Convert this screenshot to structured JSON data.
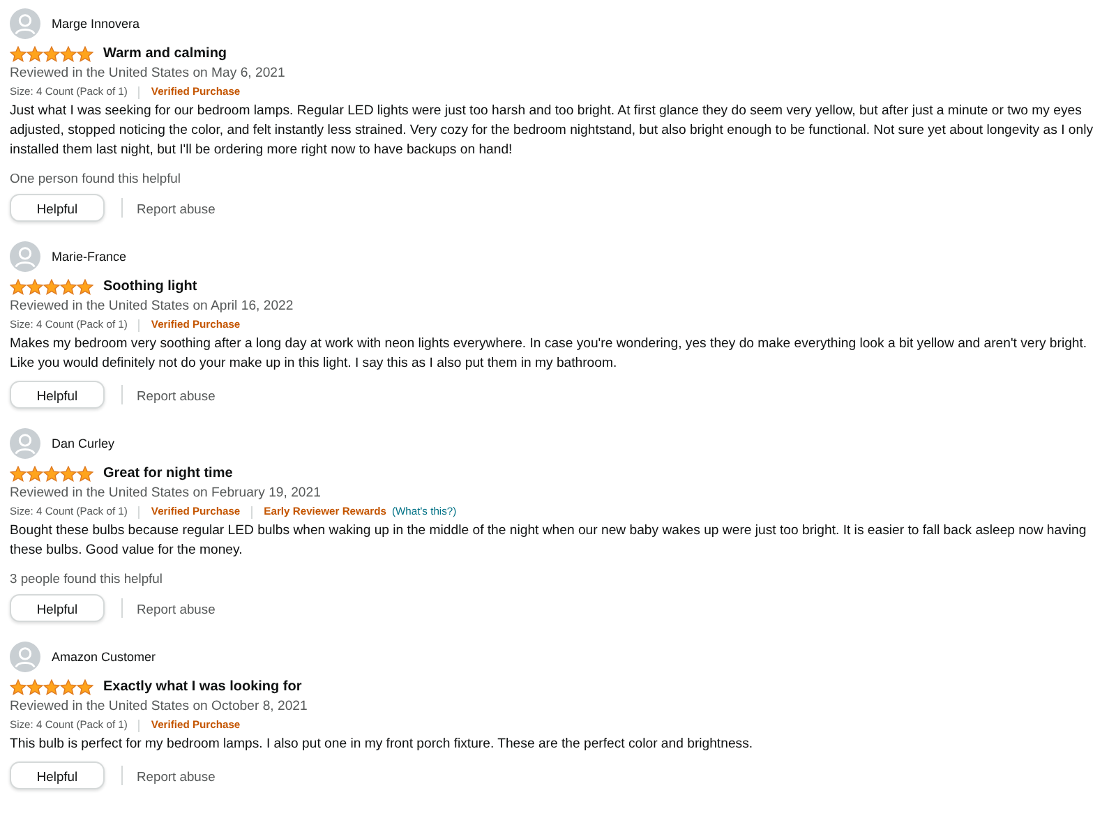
{
  "reviews": [
    {
      "author": "Marge Innovera",
      "stars": 5,
      "title": "Warm and calming",
      "date": "Reviewed in the United States on May 6, 2021",
      "size": "Size: 4 Count (Pack of 1)",
      "badges": [
        {
          "kind": "verified",
          "text": "Verified Purchase"
        }
      ],
      "body": "Just what I was seeking for our bedroom lamps. Regular LED lights were just too harsh and too bright. At first glance they do seem very yellow, but after just a minute or two my eyes adjusted, stopped noticing the color, and felt instantly less strained. Very cozy for the bedroom nightstand, but also bright enough to be functional. Not sure yet about longevity as I only installed them last night, but I'll be ordering more right now to have backups on hand!",
      "helpful_count": "One person found this helpful",
      "helpful_button": "Helpful",
      "report": "Report abuse"
    },
    {
      "author": "Marie-France",
      "stars": 5,
      "title": "Soothing light",
      "date": "Reviewed in the United States on April 16, 2022",
      "size": "Size: 4 Count (Pack of 1)",
      "badges": [
        {
          "kind": "verified",
          "text": "Verified Purchase"
        }
      ],
      "body": "Makes my bedroom very soothing after a long day at work with neon lights everywhere. In case you're wondering, yes they do make everything look a bit yellow and aren't very bright. Like you would definitely not do your make up in this light. I say this as I also put them in my bathroom.",
      "helpful_button": "Helpful",
      "report": "Report abuse"
    },
    {
      "author": "Dan Curley",
      "stars": 5,
      "title": "Great for night time",
      "date": "Reviewed in the United States on February 19, 2021",
      "size": "Size: 4 Count (Pack of 1)",
      "badges": [
        {
          "kind": "verified",
          "text": "Verified Purchase"
        },
        {
          "kind": "early",
          "text": "Early Reviewer Rewards"
        },
        {
          "kind": "link",
          "text": "(What's this?)"
        }
      ],
      "body": "Bought these bulbs because regular LED bulbs when waking up in the middle of the night when our new baby wakes up were just too bright. It is easier to fall back asleep now having these bulbs. Good value for the money.",
      "helpful_count": "3 people found this helpful",
      "helpful_button": "Helpful",
      "report": "Report abuse"
    },
    {
      "author": "Amazon Customer",
      "stars": 5,
      "title": "Exactly what I was looking for",
      "date": "Reviewed in the United States on October 8, 2021",
      "size": "Size: 4 Count (Pack of 1)",
      "badges": [
        {
          "kind": "verified",
          "text": "Verified Purchase"
        }
      ],
      "body": "This bulb is perfect for my bedroom lamps. I also put one in my front porch fixture. These are the perfect color and brightness.",
      "helpful_button": "Helpful",
      "report": "Report abuse"
    }
  ]
}
